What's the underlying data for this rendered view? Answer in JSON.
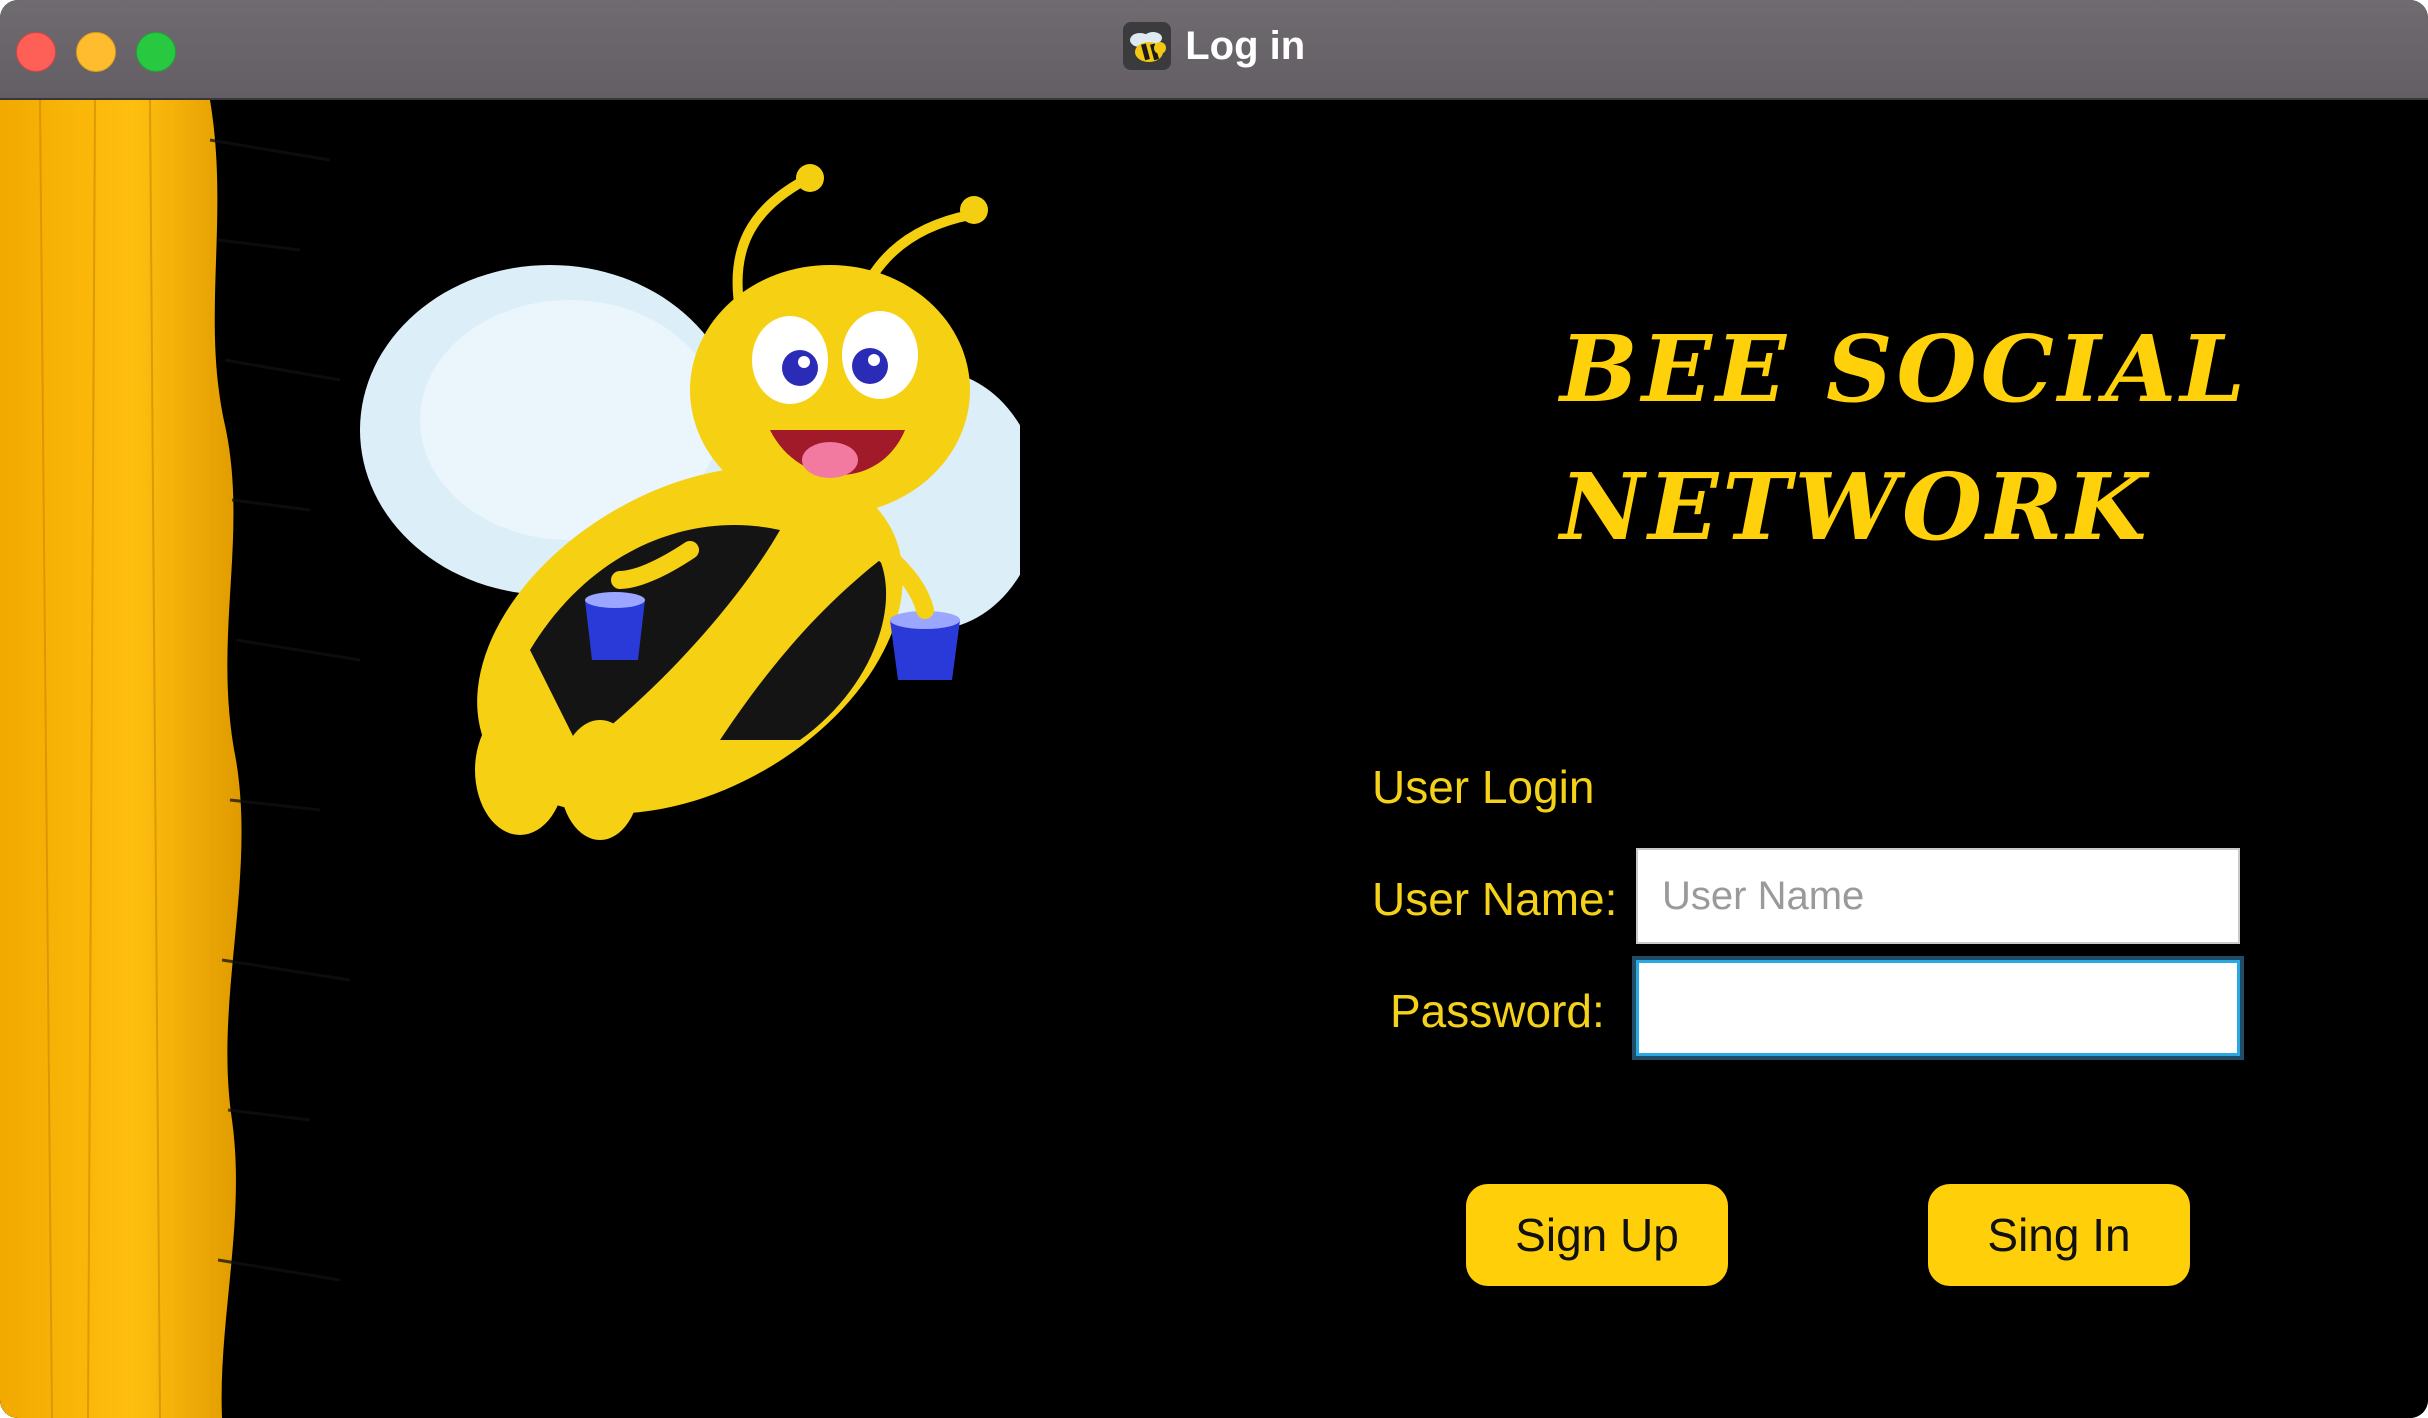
{
  "window": {
    "title": "Log in",
    "controls": [
      "close",
      "minimize",
      "zoom"
    ]
  },
  "brand": {
    "line1": "Bee Social",
    "line2": "Network",
    "color": "#ffd10a"
  },
  "form": {
    "title": "User Login",
    "username_label": "User Name:",
    "username_placeholder": "User Name",
    "username_value": "",
    "password_label": "Password:",
    "password_value": ""
  },
  "buttons": {
    "sign_up": "Sign Up",
    "sign_in": "Sing In"
  },
  "colors": {
    "accent_yellow": "#ffd00a",
    "background": "#000000",
    "focus_ring": "#2aa9e0"
  },
  "icons": {
    "app_icon": "bee-icon",
    "illustration": "bee-mascot"
  }
}
